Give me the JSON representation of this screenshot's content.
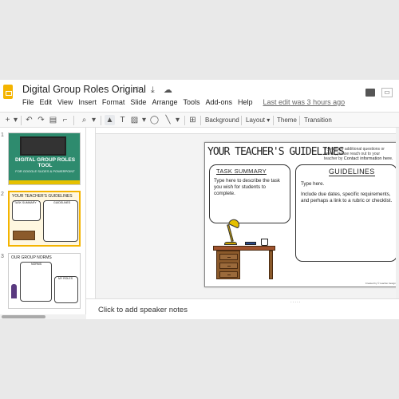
{
  "app": {
    "title": "Digital Group Roles Original",
    "title_icons": "☆ ⤓ ☁",
    "last_edit": "Last edit was 3 hours ago",
    "present_icon": "▭"
  },
  "menu": [
    "File",
    "Edit",
    "View",
    "Insert",
    "Format",
    "Slide",
    "Arrange",
    "Tools",
    "Add-ons",
    "Help"
  ],
  "toolbar": {
    "new_slide": "+",
    "dropdown": "▾",
    "undo": "↶",
    "redo": "↷",
    "print": "▤",
    "paint_format": "⌐",
    "zoom": "⌕",
    "select": "▲",
    "text_box": "T",
    "image": "▨",
    "shape": "◯",
    "line": "╲",
    "comment": "⊞",
    "background": "Background",
    "layout": "Layout ▾",
    "theme": "Theme",
    "transition": "Transition"
  },
  "filmstrip": {
    "slides": [
      {
        "number": "1",
        "title": "DIGITAL GROUP ROLES TOOL",
        "subtitle": "FOR GOOGLE SLIDES & POWERPOINT"
      },
      {
        "number": "2",
        "title": "YOUR TEACHER'S GUIDELINES",
        "label_a": "TASK SUMMARY",
        "label_b": "GUIDELINES"
      },
      {
        "number": "3",
        "title": "OUR GROUP NORMS",
        "label_a": "NORMS",
        "label_b": "MY ROLES"
      }
    ]
  },
  "slide": {
    "heading": "YOUR TEACHER'S GUIDELINES",
    "note_line1": "If you have additional questions or",
    "note_line2": "needs, please reach out to your",
    "note_line3_a": "teacher by",
    "note_contact": "Contact information here.",
    "task_title": "TASK SUMMARY",
    "task_body": "Type here to describe the task you wish for students to complete.",
    "guidelines_title": "GUIDELINES",
    "guidelines_body_1": "Type here.",
    "guidelines_body_2": "Include due dates, specific requirements, and perhaps a link to a rubric or checklist.",
    "footer": "Created by © teacher design"
  },
  "notes": {
    "placeholder": "Click to add speaker notes",
    "grip": "....."
  },
  "colors": {
    "brand_yellow": "#f4b400",
    "cover_green": "#2e8b6e"
  }
}
